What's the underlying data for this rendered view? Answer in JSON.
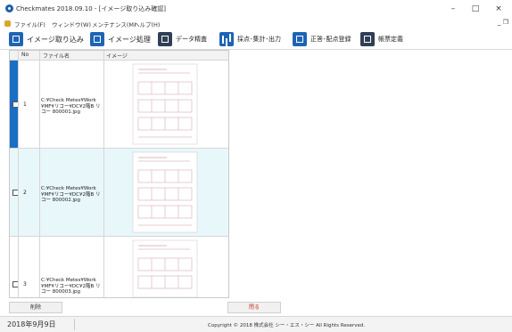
{
  "window": {
    "title": "Checkmates 2018.09.10 - [イメージ取り込み確認]",
    "controls": [
      "–",
      "□",
      "×"
    ]
  },
  "menu": {
    "items": [
      "ファイル(F)",
      "ウィンドウ(W)",
      "メンテナンス(M)",
      "ヘルプ(H)"
    ],
    "mdi_controls": "_ ❐"
  },
  "toolbar": {
    "import_label": "イメージ取り込み",
    "process_label": "イメージ処理",
    "data_review_label": "データ精査",
    "scoring_label": "採点･集計･出力",
    "answer_label": "正答･配点登録",
    "form_label": "帳票定義"
  },
  "grid": {
    "columns": [
      "No",
      "ファイル名",
      "イメージ"
    ],
    "rows": [
      {
        "no": "1",
        "filename": "C:¥Check Metes¥Work¥MF¥リコー¥DC¥2階B リコー 800001.jpg",
        "selected": true
      },
      {
        "no": "2",
        "filename": "C:¥Check Metes¥Work¥MF¥リコー¥DC¥2階B リコー 800002.jpg",
        "selected": false
      },
      {
        "no": "3",
        "filename": "C:¥Check Metes¥Work¥MF¥リコー¥DC¥2階B リコー 800003.jpg",
        "selected": false
      }
    ]
  },
  "buttons": {
    "delete_label": "削除",
    "close_label": "閉る"
  },
  "status": {
    "date": "2018年9月9日",
    "copyright": "Copyright © 2018 株式会社 シー・エス・シー All Rights Reserved."
  },
  "colors": {
    "selection": "#1a6fc4",
    "alt_row": "#e8f7fa",
    "toolbar_icon": "#1e64b4",
    "close_text": "#c0392b"
  }
}
